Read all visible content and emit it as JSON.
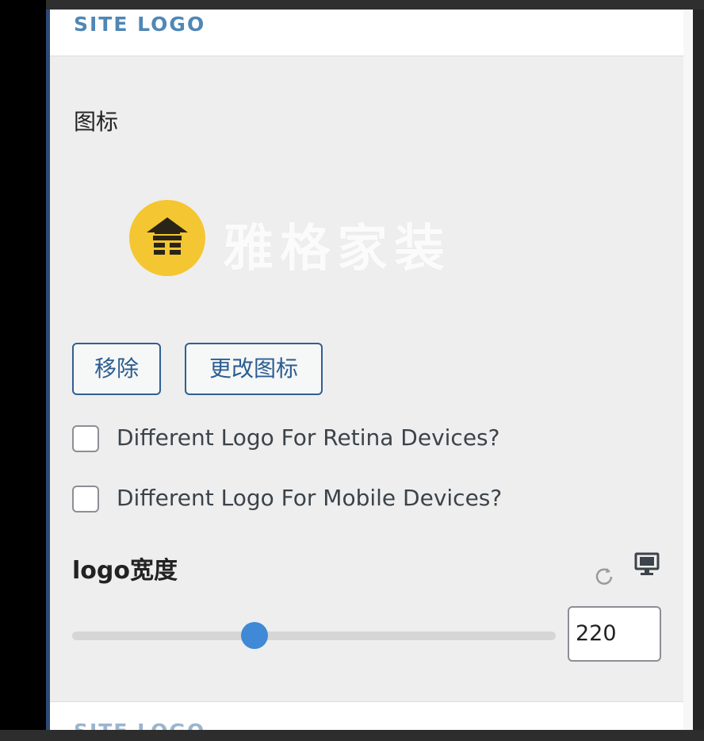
{
  "section": {
    "title": "SITE LOGO",
    "next_title": "SITE LOGO"
  },
  "logo_control": {
    "label": "图标",
    "preview_text": "雅格家装",
    "preview_icon": "house-icon"
  },
  "buttons": {
    "remove": "移除",
    "change": "更改图标"
  },
  "checkboxes": [
    {
      "label": "Different Logo For Retina Devices?",
      "checked": false
    },
    {
      "label": "Different Logo For Mobile Devices?",
      "checked": false
    }
  ],
  "width_control": {
    "label": "logo宽度",
    "value": "220",
    "reset_icon": "reset-icon",
    "device_icon": "desktop-icon"
  },
  "colors": {
    "accent": "#3f89d6",
    "logo_yellow": "#f4c631",
    "button_text": "#2c5d91"
  }
}
